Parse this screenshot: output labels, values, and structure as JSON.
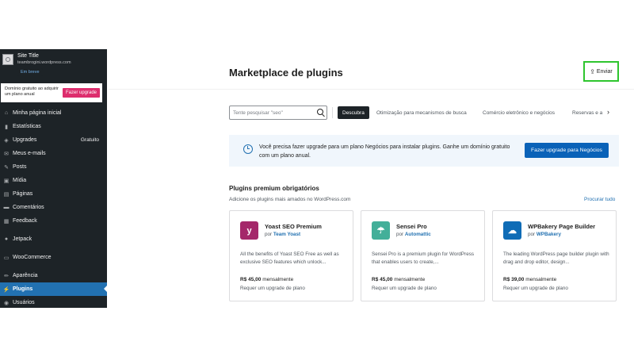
{
  "sidebar": {
    "site_title": "Site Title",
    "site_url": "teambrogini.wordpress.com",
    "site_badge": "Em breve",
    "promo_text": "Domínio gratuito ao adquirir um plano anual",
    "promo_button": "Fazer upgrade",
    "items": [
      {
        "label": "Minha página inicial",
        "icon": "home-icon",
        "glyph": "⌂"
      },
      {
        "label": "Estatísticas",
        "icon": "stats-icon",
        "glyph": "▮"
      },
      {
        "label": "Upgrades",
        "icon": "upgrades-icon",
        "glyph": "◈",
        "meta": "Gratuito"
      },
      {
        "label": "Meus e-mails",
        "icon": "mail-icon",
        "glyph": "✉"
      },
      {
        "label": "Posts",
        "icon": "pin-icon",
        "glyph": "✎"
      },
      {
        "label": "Mídia",
        "icon": "media-icon",
        "glyph": "▣"
      },
      {
        "label": "Páginas",
        "icon": "pages-icon",
        "glyph": "▤"
      },
      {
        "label": "Comentários",
        "icon": "comments-icon",
        "glyph": "▬"
      },
      {
        "label": "Feedback",
        "icon": "feedback-icon",
        "glyph": "▦"
      },
      {
        "label": "Jetpack",
        "icon": "jetpack-icon",
        "glyph": "●"
      },
      {
        "label": "WooCommerce",
        "icon": "woocommerce-icon",
        "glyph": "▭"
      },
      {
        "label": "Aparência",
        "icon": "appearance-icon",
        "glyph": "✏"
      },
      {
        "label": "Plugins",
        "icon": "plugins-icon",
        "glyph": "⚡"
      },
      {
        "label": "Usuários",
        "icon": "users-icon",
        "glyph": "◉"
      }
    ]
  },
  "header": {
    "title": "Marketplace de plugins",
    "upload_label": "Enviar"
  },
  "search": {
    "placeholder": "Tente pesquisar \"seo\""
  },
  "tabs": [
    "Descubra",
    "Otimização para mecanismos de busca",
    "Comércio eletrônico e negócios",
    "Reservas e a"
  ],
  "notice": {
    "text": "Você precisa fazer upgrade para um plano Negócios para instalar plugins. Ganhe um domínio gratuito com um plano anual.",
    "button": "Fazer upgrade para Negócios"
  },
  "premium": {
    "title": "Plugins premium obrigatórios",
    "subtitle": "Adicione os plugins mais amados no WordPress.com",
    "browse_all": "Procurar tudo",
    "cards": [
      {
        "name": "Yoast SEO Premium",
        "by": "por",
        "author": "Team Yoast",
        "description": "All the benefits of Yoast SEO Free as well as exclusive SEO features which unlock...",
        "price": "R$ 45,00",
        "period": "mensalmente",
        "requirement": "Requer um upgrade de plano",
        "logo_color": "#a4286a",
        "logo_glyph": "y"
      },
      {
        "name": "Sensei Pro",
        "by": "por",
        "author": "Automattic",
        "description": "Sensei Pro is a premium plugin for WordPress that enables users to create,...",
        "price": "R$ 45,00",
        "period": "mensalmente",
        "requirement": "Requer um upgrade de plano",
        "logo_color": "#43af99",
        "logo_glyph": "☂"
      },
      {
        "name": "WPBakery Page Builder",
        "by": "por",
        "author": "WPBakery",
        "description": "The leading WordPress page builder plugin with drag and drop editor, design...",
        "price": "R$ 39,00",
        "period": "mensalmente",
        "requirement": "Requer um upgrade de plano",
        "logo_color": "#0f6cb6",
        "logo_glyph": "☁"
      }
    ]
  }
}
